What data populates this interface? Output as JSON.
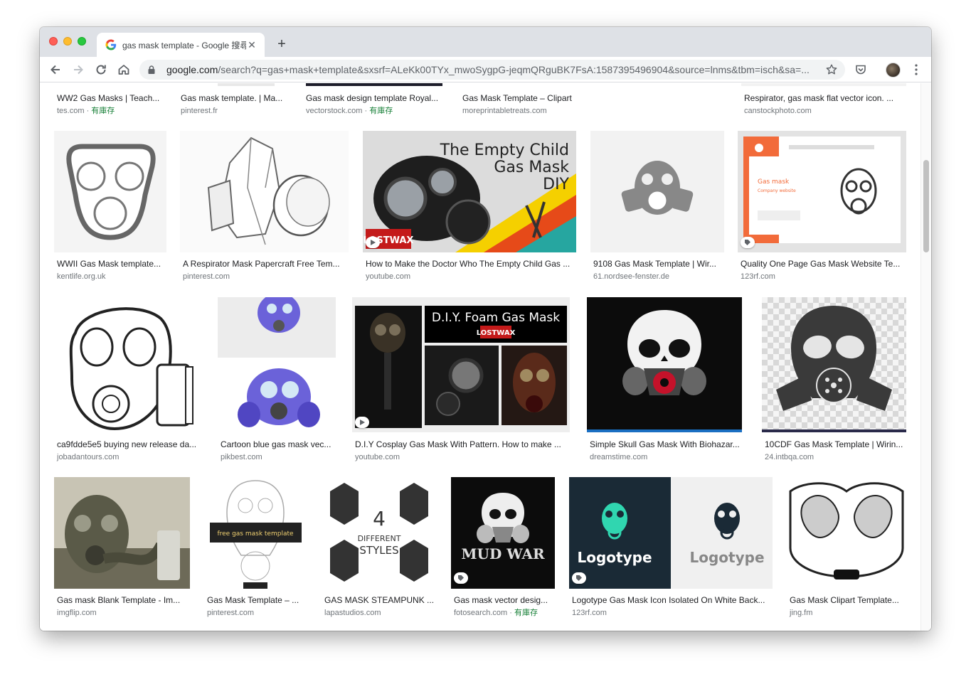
{
  "browser": {
    "tab_title": "gas mask template - Google 搜尋",
    "url_host": "google.com",
    "url_path": "/search?q=gas+mask+template&sxsrf=ALeKk00TYx_mwoSygpG-jeqmQRguBK7FsA:1587395496904&source=lnms&tbm=isch&sa=..."
  },
  "stock_label": "有庫存",
  "row0": [
    {
      "title": "WW2 Gas Masks | Teach...",
      "source": "tes.com",
      "stock": true
    },
    {
      "title": "Gas mask template. | Ma...",
      "source": "pinterest.fr",
      "stock": false
    },
    {
      "title": "Gas mask design template Royal...",
      "source": "vectorstock.com",
      "stock": true
    },
    {
      "title": "Gas Mask Template – Clipart",
      "source": "moreprintabletreats.com",
      "stock": false
    },
    {
      "title": "Respirator, gas mask flat vector icon. ...",
      "source": "canstockphoto.com",
      "stock": false
    }
  ],
  "row1": [
    {
      "title": "WWII Gas Mask template...",
      "source": "kentlife.org.uk",
      "badge": ""
    },
    {
      "title": "A Respirator Mask Papercraft Free Tem...",
      "source": "pinterest.com",
      "badge": ""
    },
    {
      "title": "How to Make the Doctor Who The Empty Child Gas ...",
      "source": "youtube.com",
      "badge": "play",
      "img_text1": "The Empty Child",
      "img_text2": "Gas Mask",
      "img_text3": "DIY",
      "img_logo": "LOSTWAX"
    },
    {
      "title": "9108 Gas Mask Template | Wir...",
      "source": "61.nordsee-fenster.de",
      "badge": ""
    },
    {
      "title": "Quality One Page Gas Mask Website Te...",
      "source": "123rf.com",
      "badge": "tag",
      "img_text1": "Gas mask",
      "img_text2": "Company website"
    }
  ],
  "row2": [
    {
      "title": "ca9fdde5e5 buying new release da...",
      "source": "jobadantours.com",
      "badge": ""
    },
    {
      "title": "Cartoon blue gas mask vec...",
      "source": "pikbest.com",
      "badge": ""
    },
    {
      "title": "D.I.Y Cosplay Gas Mask With Pattern. How to make ...",
      "source": "youtube.com",
      "badge": "play",
      "img_text1": "D.I.Y. Foam Gas Mask",
      "img_logo": "LOSTWAX"
    },
    {
      "title": "Simple Skull Gas Mask With Biohazar...",
      "source": "dreamstime.com",
      "badge": ""
    },
    {
      "title": "10CDF Gas Mask Template | Wirin...",
      "source": "24.intbqa.com",
      "badge": ""
    }
  ],
  "row3": [
    {
      "title": "Gas mask Blank Template - Im...",
      "source": "imgflip.com",
      "stock": false,
      "badge": ""
    },
    {
      "title": "Gas Mask Template – ...",
      "source": "pinterest.com",
      "stock": false,
      "badge": "",
      "img_text1": "free gas mask template"
    },
    {
      "title": "GAS MASK STEAMPUNK ...",
      "source": "lapastudios.com",
      "stock": false,
      "badge": "",
      "img_text1": "4",
      "img_text2": "DIFFERENT",
      "img_text3": "STYLES"
    },
    {
      "title": "Gas mask vector desig...",
      "source": "fotosearch.com",
      "stock": true,
      "badge": "tag",
      "img_text1": "MUD WAR"
    },
    {
      "title": "Logotype Gas Mask Icon Isolated On White Back...",
      "source": "123rf.com",
      "stock": false,
      "badge": "tag",
      "img_text1": "Logotype",
      "img_text2": "Logotype"
    },
    {
      "title": "Gas Mask Clipart Template...",
      "source": "jing.fm",
      "stock": false,
      "badge": ""
    }
  ]
}
